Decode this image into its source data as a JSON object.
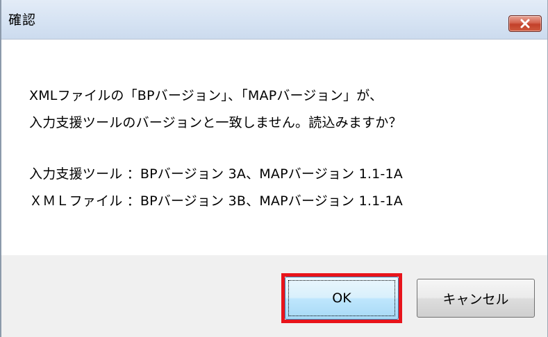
{
  "window": {
    "title": "確認"
  },
  "message": {
    "line1": "XMLファイルの「BPバージョン」、「MAPバージョン」が、",
    "line2": "入力支援ツールのバージョンと一致しません。読込みますか？",
    "line3": "入力支援ツール ：BPバージョン 3A、MAPバージョン 1.1-1A",
    "line4": "ＸＭＬファイル ：BPバージョン 3B、MAPバージョン 1.1-1A"
  },
  "buttons": {
    "ok_label": "OK",
    "cancel_label": "キャンセル"
  },
  "colors": {
    "highlight": "#e8141b",
    "close_button": "#c2402a",
    "titlebar": "#d6e3f3"
  },
  "icons": {
    "close": "close-icon"
  }
}
